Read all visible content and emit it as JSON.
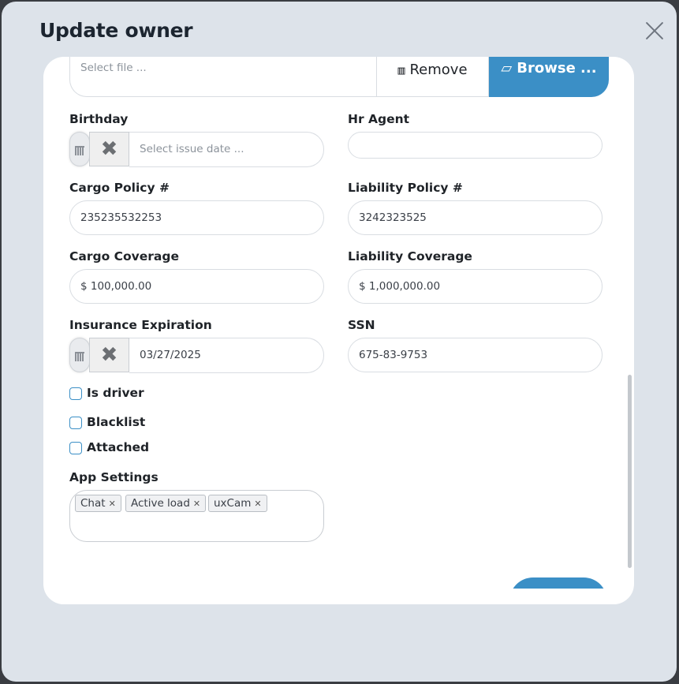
{
  "modal": {
    "title": "Update owner"
  },
  "file": {
    "placeholder": "Select file ...",
    "remove_label": "Remove",
    "browse_label": "Browse ..."
  },
  "fields": {
    "birthday": {
      "label": "Birthday",
      "placeholder": "Select issue date ..."
    },
    "hr_agent": {
      "label": "Hr Agent",
      "value": ""
    },
    "cargo_policy": {
      "label": "Cargo Policy #",
      "value": "235235532253"
    },
    "liability_policy": {
      "label": "Liability Policy #",
      "value": "3242323525"
    },
    "cargo_coverage": {
      "label": "Cargo Coverage",
      "value": "$ 100,000.00"
    },
    "liability_coverage": {
      "label": "Liability Coverage",
      "value": "$ 1,000,000.00"
    },
    "insurance_expiration": {
      "label": "Insurance Expiration",
      "value": "03/27/2025"
    },
    "ssn": {
      "label": "SSN",
      "value": "675-83-9753"
    }
  },
  "checkboxes": [
    {
      "label": "Is driver",
      "checked": false
    },
    {
      "label": "Blacklist",
      "checked": false
    },
    {
      "label": "Attached",
      "checked": false
    }
  ],
  "app_settings": {
    "label": "App Settings",
    "tags": [
      "Chat",
      "Active load",
      "uxCam"
    ]
  },
  "icons": {
    "close": "close-icon",
    "remove": "remove-icon",
    "browse": "folder-open-icon",
    "calendar": "calendar-icon",
    "clear": "clear-x-icon",
    "tag_remove": "tag-remove-icon"
  },
  "colors": {
    "accent": "#3b8fc6",
    "modal_bg": "#dde3ea"
  }
}
